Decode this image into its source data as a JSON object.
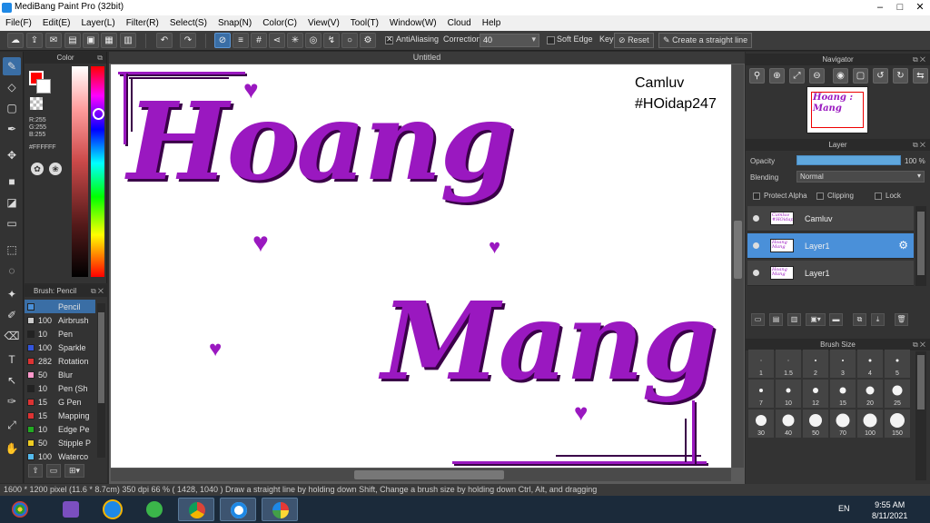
{
  "app": {
    "title": "MediBang Paint Pro (32bit)",
    "browser_tabs": [
      "",
      "",
      "",
      "",
      "",
      "",
      "",
      "",
      "",
      "",
      "",
      "",
      "",
      ""
    ]
  },
  "menu": [
    "File(F)",
    "Edit(E)",
    "Layer(L)",
    "Filter(R)",
    "Select(S)",
    "Snap(N)",
    "Color(C)",
    "View(V)",
    "Tool(T)",
    "Window(W)",
    "Cloud",
    "Help"
  ],
  "toolbar": {
    "antialiasing_label": "AntiAliasing",
    "correction_label": "Correction",
    "correction_value": "40",
    "soft_edge_label": "Soft Edge",
    "key_label": "Key",
    "reset_label": "Reset",
    "straight_line_label": "Create a straight line"
  },
  "color_panel": {
    "title": "Color",
    "r": "R:255",
    "g": "G:255",
    "b": "B:255",
    "hex": "#FFFFFF",
    "foreground": "#ff0000",
    "background": "#ffffff"
  },
  "brush_panel": {
    "title": "Brush: Pencil",
    "items": [
      {
        "size": "",
        "name": "Pencil",
        "color": "#4a90d9"
      },
      {
        "size": "100",
        "name": "Airbrush",
        "color": "#cccccc"
      },
      {
        "size": "10",
        "name": "Pen",
        "color": "#222222"
      },
      {
        "size": "100",
        "name": "Sparkle",
        "color": "#3355dd"
      },
      {
        "size": "282",
        "name": "Rotation",
        "color": "#dd3333"
      },
      {
        "size": "50",
        "name": "Blur",
        "color": "#ff99cc"
      },
      {
        "size": "10",
        "name": "Pen (Sh",
        "color": "#222222"
      },
      {
        "size": "15",
        "name": "G Pen",
        "color": "#dd3333"
      },
      {
        "size": "15",
        "name": "Mapping",
        "color": "#dd3333"
      },
      {
        "size": "10",
        "name": "Edge Pe",
        "color": "#22aa22"
      },
      {
        "size": "50",
        "name": "Stipple P",
        "color": "#eecc22"
      },
      {
        "size": "100",
        "name": "Waterco",
        "color": "#55bbee"
      }
    ]
  },
  "canvas": {
    "tab_title": "Untitled",
    "text_line1": "Hoang",
    "text_line2": "Mang",
    "caption1": "Camluv",
    "caption2": "#HOidap247",
    "ink_color": "#9a18c0"
  },
  "navigator": {
    "title": "Navigator",
    "thumb_text1": "Hoang :",
    "thumb_text2": "Mang"
  },
  "layer_panel": {
    "title": "Layer",
    "opacity_label": "Opacity",
    "opacity_value": "100 %",
    "blending_label": "Blending",
    "blending_value": "Normal",
    "protect_alpha_label": "Protect Alpha",
    "clipping_label": "Clipping",
    "lock_label": "Lock",
    "layers": [
      {
        "name": "Camluv",
        "thumb": "Camluv #HOidap247"
      },
      {
        "name": "Layer1",
        "thumb": "Hoang Mang"
      },
      {
        "name": "Layer1",
        "thumb": "Hoang Mang"
      }
    ]
  },
  "brush_size": {
    "title": "Brush Size",
    "sizes": [
      "1",
      "1.5",
      "2",
      "3",
      "4",
      "5",
      "7",
      "10",
      "12",
      "15",
      "20",
      "25",
      "30",
      "40",
      "50",
      "70",
      "100",
      "150"
    ]
  },
  "status": {
    "text": "1600 * 1200 pixel   (11.6 * 8.7cm)   350 dpi   66 %   ( 1428, 1040 )   Draw a straight line by holding down Shift, Change a brush size by holding down Ctrl, Alt, and dragging"
  },
  "taskbar": {
    "lang": "EN",
    "time": "9:55 AM",
    "date": "8/11/2021"
  }
}
